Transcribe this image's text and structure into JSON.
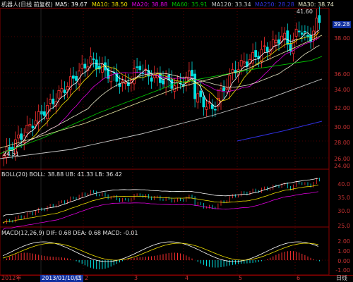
{
  "header": {
    "title": "机器人(日线 前复权)",
    "ma": [
      {
        "label": "MA5: 39.67",
        "color": "#ffffff"
      },
      {
        "label": "MA10: 38.50",
        "color": "#f0e000"
      },
      {
        "label": "MA20: 38.88",
        "color": "#e000e0"
      },
      {
        "label": "MA60: 35.91",
        "color": "#00c000"
      },
      {
        "label": "MA120: 33.34",
        "color": "#c8c8c8"
      },
      {
        "label": "MA250: 28.28",
        "color": "#3030e0"
      },
      {
        "label": "MA30: 38.74",
        "color": "#e8e8c8"
      }
    ]
  },
  "price_panel": {
    "high_mark": "41.60",
    "low_mark": "24.51",
    "last_price": "39.28",
    "y_labels": [
      "38.00",
      "36.00",
      "34.00",
      "32.00",
      "30.00",
      "28.00",
      "26.00",
      "24.00"
    ]
  },
  "boll_panel": {
    "header": "BOLL(20)  BOLL: 38.88  UB: 41.33  LB: 36.42",
    "y_labels": [
      "40.0",
      "35.0",
      "30.0",
      "25.0"
    ]
  },
  "macd_panel": {
    "header": "MACD(12,26,9)  DIF: 0.68  DEA: 0.68  MACD: -0.01",
    "y_labels": [
      "2.00",
      "1.00",
      "0.00",
      "-1.00"
    ]
  },
  "bottom": {
    "year": "2012年",
    "date": "2013/01/10/四",
    "months": [
      "2",
      "3",
      "4",
      "5",
      "6"
    ],
    "mode": "日线"
  },
  "colors": {
    "up": "#ff3030",
    "down": "#00e0e0",
    "frame": "#8b0000",
    "axis_text": "#c83232"
  }
}
